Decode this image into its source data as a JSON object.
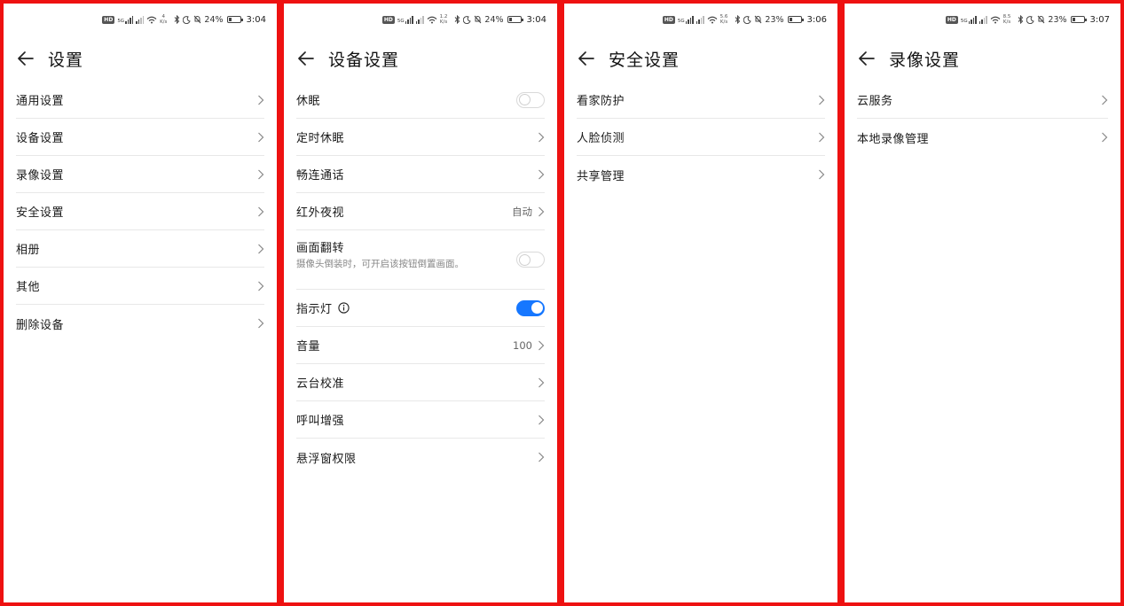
{
  "panels": [
    {
      "status": {
        "speed_top": "4",
        "speed_unit": "K/s",
        "battery": "24%",
        "time": "3:04"
      },
      "title": "设置",
      "items": [
        {
          "label": "通用设置"
        },
        {
          "label": "设备设置"
        },
        {
          "label": "录像设置"
        },
        {
          "label": "安全设置"
        },
        {
          "label": "相册"
        },
        {
          "label": "其他"
        },
        {
          "label": "删除设备"
        }
      ]
    },
    {
      "status": {
        "speed_top": "1.2",
        "speed_unit": "K/s",
        "battery": "24%",
        "time": "3:04"
      },
      "title": "设备设置",
      "items": [
        {
          "label": "休眠",
          "toggle": false
        },
        {
          "label": "定时休眠"
        },
        {
          "label": "畅连通话"
        },
        {
          "label": "红外夜视",
          "value": "自动"
        },
        {
          "label": "画面翻转",
          "sub": "摄像头倒装时，可开启该按钮倒置画面。",
          "toggle": false
        },
        {
          "label": "指示灯",
          "toggle": true
        },
        {
          "label": "音量",
          "value": "100"
        },
        {
          "label": "云台校准"
        },
        {
          "label": "呼叫增强"
        },
        {
          "label": "悬浮窗权限"
        }
      ]
    },
    {
      "status": {
        "speed_top": "5.6",
        "speed_unit": "K/s",
        "battery": "23%",
        "time": "3:06"
      },
      "title": "安全设置",
      "items": [
        {
          "label": "看家防护"
        },
        {
          "label": "人脸侦测"
        },
        {
          "label": "共享管理"
        }
      ]
    },
    {
      "status": {
        "speed_top": "8.5",
        "speed_unit": "K/s",
        "battery": "23%",
        "time": "3:07"
      },
      "title": "录像设置",
      "items": [
        {
          "label": "云服务"
        },
        {
          "label": "本地录像管理"
        }
      ]
    }
  ],
  "colors": {
    "accent": "#1677ff",
    "frame": "#ee1111",
    "divider": "#e8e8e8"
  },
  "icons": {
    "back": "arrow-left-icon",
    "chevron": "chevron-right-icon",
    "info": "info-circle-icon"
  }
}
